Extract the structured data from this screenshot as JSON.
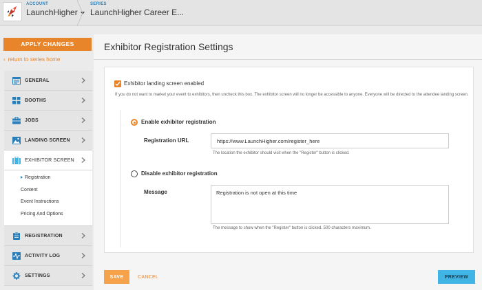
{
  "header": {
    "account_label": "ACCOUNT",
    "account_name": "LaunchHigher",
    "series_label": "SERIES",
    "series_name": "LaunchHigher Career E..."
  },
  "sidebar": {
    "apply_label": "APPLY CHANGES",
    "return_label": "return to series home",
    "items": [
      {
        "label": "GENERAL",
        "icon": "general-icon"
      },
      {
        "label": "BOOTHS",
        "icon": "grid-icon"
      },
      {
        "label": "JOBS",
        "icon": "briefcase-icon"
      },
      {
        "label": "LANDING SCREEN",
        "icon": "image-icon"
      },
      {
        "label": "EXHIBITOR SCREEN",
        "icon": "exhibitor-icon"
      },
      {
        "label": "REGISTRATION",
        "icon": "clipboard-icon"
      },
      {
        "label": "ACTIVITY LOG",
        "icon": "activity-icon"
      },
      {
        "label": "SETTINGS",
        "icon": "gear-icon"
      }
    ],
    "subitems": [
      "Registration",
      "Content",
      "Event Instructions",
      "Pricing And Options"
    ]
  },
  "main": {
    "title": "Exhibitor Registration Settings",
    "checkbox_label": "Exhibitor landing screen enabled",
    "checkbox_help": "If you do not want to market your event to exhibitors, then uncheck this box. The exhibitor screen will no longer be accessible to anyone. Everyone will be directed to the attendee landing screen.",
    "enable_label": "Enable exhibitor registration",
    "url_label": "Registration URL",
    "url_value": "https://www.LaunchHigher.com/register_here",
    "url_hint": "The location the exhibitor should visit when the \"Register\" button is clicked.",
    "disable_label": "Disable exhibitor registration",
    "message_label": "Message",
    "message_value": "Registration is not open at this time",
    "message_hint": "The message to show when the \"Register\" button is clicked. 500 characters maximum."
  },
  "footer": {
    "save_label": "SAVE",
    "cancel_label": "CANCEL",
    "preview_label": "PREVIEW"
  },
  "colors": {
    "accent": "#e8852a",
    "preview": "#3fb4e5",
    "link": "#2b7fb8"
  }
}
